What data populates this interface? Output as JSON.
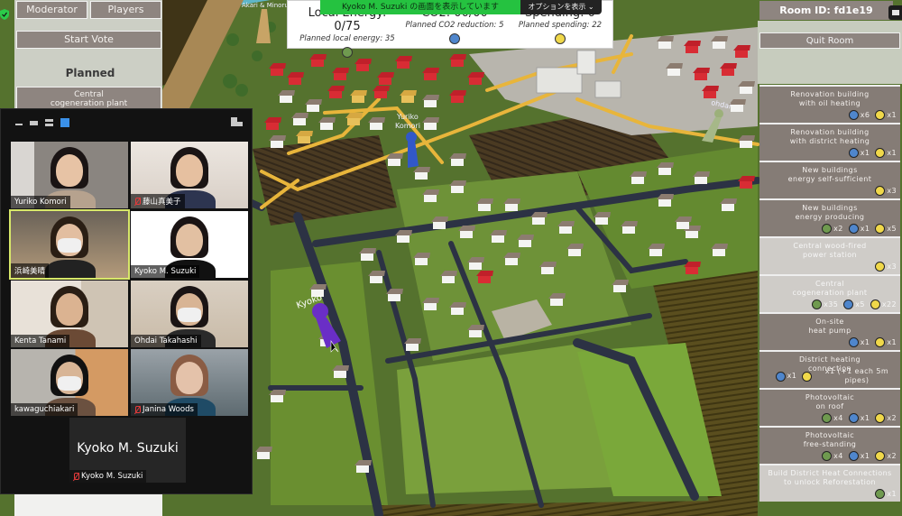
{
  "game": {
    "left_panel": {
      "moderator_label": "Moderator",
      "players_label": "Players",
      "start_vote_label": "Start Vote",
      "status_label": "Planned",
      "selected_item_label_line1": "Central",
      "selected_item_label_line2": "cogeneration plant"
    },
    "stats": {
      "local_energy": {
        "label": "Local Energy: 0/75",
        "planned": "Planned local energy: 35",
        "color": "#6f9a4f"
      },
      "co2": {
        "label": "CO2: 00/00",
        "planned": "Planned CO2 reduction: 5",
        "color": "#4f86cc"
      },
      "spending": {
        "label": "Spending: 0",
        "planned": "Planned spending: 22",
        "color": "#f0d84a"
      }
    },
    "room": {
      "room_id_label": "Room ID: fd1e19",
      "quit_label": "Quit Room"
    },
    "map_labels": {
      "player1": "Akari & Minoru",
      "player2_line1": "Yuriko",
      "player2_line2": "Komori",
      "player3": "ohdai",
      "player4": "Kyoko"
    },
    "colors": {
      "energy": "#6f9a4f",
      "co2": "#4f86cc",
      "spending": "#f0d84a"
    },
    "measures": [
      {
        "title1": "Renovation building",
        "title2": "with oil heating",
        "enabled": true,
        "costs": [
          {
            "type": "co2",
            "count": "x6"
          },
          {
            "type": "spending",
            "count": "x1"
          }
        ]
      },
      {
        "title1": "Renovation building",
        "title2": "with district heating",
        "enabled": true,
        "costs": [
          {
            "type": "co2",
            "count": "x1"
          },
          {
            "type": "spending",
            "count": "x1"
          }
        ]
      },
      {
        "title1": "New buildings",
        "title2": "energy self-sufficient",
        "enabled": true,
        "costs": [
          {
            "type": "spending",
            "count": "x3"
          }
        ]
      },
      {
        "title1": "New buildings",
        "title2": "energy producing",
        "enabled": true,
        "costs": [
          {
            "type": "energy",
            "count": "x2"
          },
          {
            "type": "co2",
            "count": "x1"
          },
          {
            "type": "spending",
            "count": "x5"
          }
        ]
      },
      {
        "title1": "Central wood-fired",
        "title2": "power station",
        "enabled": false,
        "costs": [
          {
            "type": "spending",
            "count": "x3"
          }
        ]
      },
      {
        "title1": "Central",
        "title2": "cogeneration plant",
        "enabled": false,
        "costs": [
          {
            "type": "energy",
            "count": "x35"
          },
          {
            "type": "co2",
            "count": "x5"
          },
          {
            "type": "spending",
            "count": "x22"
          }
        ]
      },
      {
        "title1": "On-site",
        "title2": "heat pump",
        "enabled": true,
        "costs": [
          {
            "type": "co2",
            "count": "x1"
          },
          {
            "type": "spending",
            "count": "x1"
          }
        ]
      },
      {
        "title1": "District heating",
        "title2": "connection",
        "enabled": true,
        "costs": [
          {
            "type": "co2",
            "count": "x1"
          },
          {
            "type": "spending",
            "count": "x1 (+1 each 5m pipes)"
          }
        ]
      },
      {
        "title1": "Photovoltaic",
        "title2": "on roof",
        "enabled": true,
        "costs": [
          {
            "type": "energy",
            "count": "x4"
          },
          {
            "type": "co2",
            "count": "x1"
          },
          {
            "type": "spending",
            "count": "x2"
          }
        ]
      },
      {
        "title1": "Photovoltaic",
        "title2": "free-standing",
        "enabled": true,
        "costs": [
          {
            "type": "energy",
            "count": "x4"
          },
          {
            "type": "co2",
            "count": "x1"
          },
          {
            "type": "spending",
            "count": "x2"
          }
        ]
      },
      {
        "title1": "Build District Heat Connections",
        "title2": "to unlock Reforestation",
        "enabled": false,
        "costs": [
          {
            "type": "energy",
            "count": "x1"
          }
        ]
      }
    ]
  },
  "zoom": {
    "share_banner": "Kyoko M. Suzuki の画面を表示しています",
    "view_options_label": "オプションを表示 ⌄",
    "participants": [
      {
        "name": "Yuriko Komori",
        "muted": false,
        "active": false
      },
      {
        "name": "藤山真美子",
        "muted": true,
        "active": false
      },
      {
        "name": "浜崎美晴",
        "muted": false,
        "active": true
      },
      {
        "name": "Kyoko M. Suzuki",
        "muted": false,
        "active": false
      },
      {
        "name": "Kenta Tanami",
        "muted": false,
        "active": false
      },
      {
        "name": "Ohdai Takahashi",
        "muted": false,
        "active": false
      },
      {
        "name": "kawaguchiakari",
        "muted": false,
        "active": false
      },
      {
        "name": "Janina Woods",
        "muted": true,
        "active": false
      }
    ],
    "self_view": {
      "display_name": "Kyoko M. Suzuki",
      "label": "Kyoko M. Suzuki",
      "muted": true
    }
  }
}
